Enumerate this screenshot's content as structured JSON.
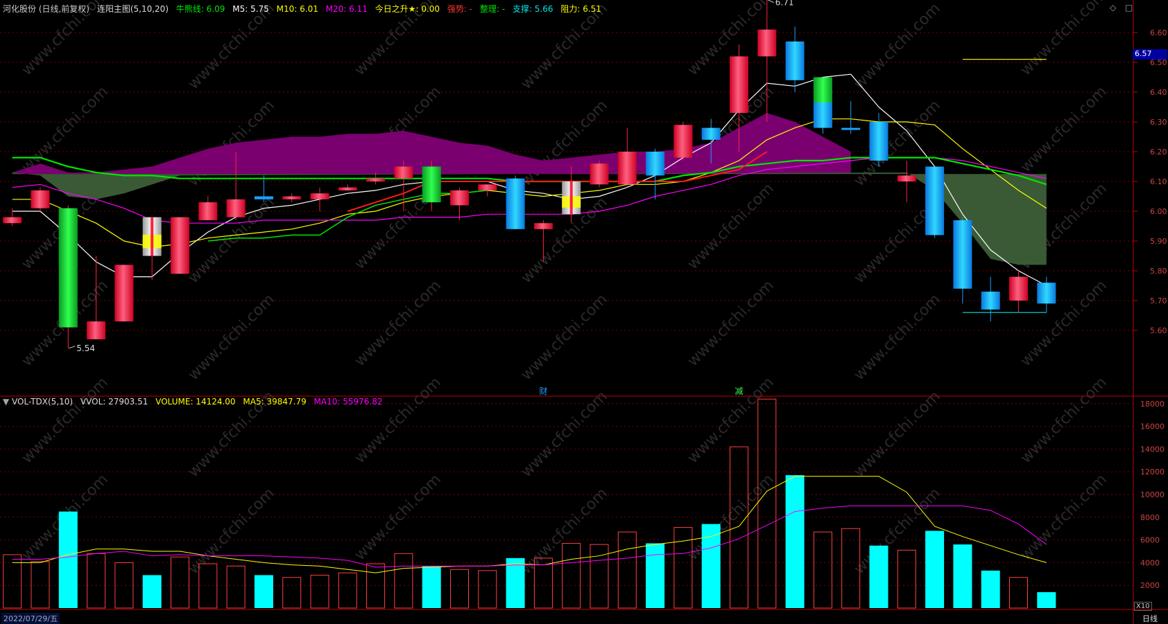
{
  "main_header": {
    "stock": "河化股份 (日线,前复权)",
    "indicator": "连阳主图(5,10,20)",
    "fields": [
      {
        "label": "牛熊线: 6.09",
        "color": "#00e600"
      },
      {
        "label": "M5: 5.75",
        "color": "#ffffff"
      },
      {
        "label": "M10: 6.01",
        "color": "#ffff00"
      },
      {
        "label": "M20: 6.11",
        "color": "#ff00ff"
      },
      {
        "label": "今日之升★: 0.00",
        "color": "#ffff00"
      },
      {
        "label": "强势: -",
        "color": "#ff3333"
      },
      {
        "label": "整理: -",
        "color": "#00e600"
      },
      {
        "label": "支撑: 5.66",
        "color": "#00e6e6"
      },
      {
        "label": "阻力: 6.51",
        "color": "#ffff00"
      }
    ]
  },
  "vol_header": {
    "name": "VOL-TDX(5,10)",
    "vvol": "VVOL: 27903.51",
    "volume": "VOLUME: 14124.00",
    "ma5": "MA5: 39847.79",
    "ma10": "MA10: 55976.82"
  },
  "price_axis": {
    "current_price": "6.57",
    "ticks": [
      "6.60",
      "6.50",
      "6.40",
      "6.30",
      "6.20",
      "6.10",
      "6.00",
      "5.90",
      "5.80",
      "5.70",
      "5.60"
    ]
  },
  "volume_axis": {
    "ticks": [
      "18000",
      "16000",
      "14000",
      "12000",
      "10000",
      "8000",
      "6000",
      "4000",
      "2000"
    ],
    "unit": "X10"
  },
  "annotations": {
    "high": "6.71",
    "low": "5.54",
    "mark1": "财",
    "mark2": "减"
  },
  "date_label": "2022/07/29/五",
  "period_label": "日线",
  "watermark": "www.cfchi.com",
  "colors": {
    "up": "#ff2040",
    "down": "#1aa0ff",
    "grid": "#7a0000",
    "axis": "#c00000",
    "volfill": "#00ffff"
  },
  "chart_data": [
    {
      "type": "candlestick",
      "title": "连阳主图(5,10,20)",
      "ylim": [
        5.52,
        6.72
      ],
      "candles": [
        {
          "o": 5.96,
          "c": 5.98,
          "h": 6.01,
          "l": 5.95,
          "k": "up"
        },
        {
          "o": 6.01,
          "c": 6.07,
          "h": 6.08,
          "l": 6.0,
          "k": "up"
        },
        {
          "o": 6.01,
          "c": 5.61,
          "h": 6.02,
          "l": 5.54,
          "k": "green"
        },
        {
          "o": 5.57,
          "c": 5.63,
          "h": 5.85,
          "l": 5.57,
          "k": "up"
        },
        {
          "o": 5.63,
          "c": 5.82,
          "h": 5.82,
          "l": 5.63,
          "k": "up"
        },
        {
          "o": 5.85,
          "c": 5.98,
          "h": 5.98,
          "l": 5.77,
          "k": "white"
        },
        {
          "o": 5.79,
          "c": 5.98,
          "h": 5.98,
          "l": 5.79,
          "k": "up"
        },
        {
          "o": 5.97,
          "c": 6.03,
          "h": 6.05,
          "l": 5.97,
          "k": "up"
        },
        {
          "o": 5.98,
          "c": 6.04,
          "h": 6.2,
          "l": 5.97,
          "k": "up"
        },
        {
          "o": 6.05,
          "c": 6.04,
          "h": 6.12,
          "l": 6.03,
          "k": "flat"
        },
        {
          "o": 6.04,
          "c": 6.05,
          "h": 6.06,
          "l": 6.03,
          "k": "up"
        },
        {
          "o": 6.04,
          "c": 6.06,
          "h": 6.08,
          "l": 6.0,
          "k": "up"
        },
        {
          "o": 6.07,
          "c": 6.08,
          "h": 6.09,
          "l": 6.07,
          "k": "up"
        },
        {
          "o": 6.1,
          "c": 6.11,
          "h": 6.13,
          "l": 6.09,
          "k": "up"
        },
        {
          "o": 6.11,
          "c": 6.15,
          "h": 6.17,
          "l": 6.0,
          "k": "up"
        },
        {
          "o": 6.03,
          "c": 6.15,
          "h": 6.17,
          "l": 6.0,
          "k": "green"
        },
        {
          "o": 6.02,
          "c": 6.07,
          "h": 6.08,
          "l": 5.97,
          "k": "up"
        },
        {
          "o": 6.09,
          "c": 6.07,
          "h": 6.08,
          "l": 6.05,
          "k": "up"
        },
        {
          "o": 6.11,
          "c": 5.94,
          "h": 6.12,
          "l": 5.94,
          "k": "down"
        },
        {
          "o": 5.94,
          "c": 5.96,
          "h": 5.97,
          "l": 5.83,
          "k": "up"
        },
        {
          "o": 5.99,
          "c": 6.1,
          "h": 6.15,
          "l": 5.96,
          "k": "white"
        },
        {
          "o": 6.09,
          "c": 6.16,
          "h": 6.17,
          "l": 6.08,
          "k": "up"
        },
        {
          "o": 6.09,
          "c": 6.2,
          "h": 6.28,
          "l": 6.08,
          "k": "up"
        },
        {
          "o": 6.2,
          "c": 6.12,
          "h": 6.21,
          "l": 6.04,
          "k": "down"
        },
        {
          "o": 6.18,
          "c": 6.29,
          "h": 6.3,
          "l": 6.17,
          "k": "up"
        },
        {
          "o": 6.28,
          "c": 6.24,
          "h": 6.31,
          "l": 6.16,
          "k": "down"
        },
        {
          "o": 6.33,
          "c": 6.52,
          "h": 6.56,
          "l": 6.2,
          "k": "up"
        },
        {
          "o": 6.52,
          "c": 6.61,
          "h": 6.71,
          "l": 6.3,
          "k": "up"
        },
        {
          "o": 6.57,
          "c": 6.44,
          "h": 6.62,
          "l": 6.4,
          "k": "down"
        },
        {
          "o": 6.45,
          "c": 6.28,
          "h": 6.44,
          "l": 6.26,
          "k": "greendown"
        },
        {
          "o": 6.28,
          "c": 6.28,
          "h": 6.37,
          "l": 6.26,
          "k": "flat"
        },
        {
          "o": 6.3,
          "c": 6.17,
          "h": 6.33,
          "l": 6.15,
          "k": "down"
        },
        {
          "o": 6.1,
          "c": 6.12,
          "h": 6.17,
          "l": 6.03,
          "k": "up"
        },
        {
          "o": 6.15,
          "c": 5.92,
          "h": 6.15,
          "l": 5.91,
          "k": "down"
        },
        {
          "o": 5.97,
          "c": 5.74,
          "h": 5.98,
          "l": 5.69,
          "k": "down"
        },
        {
          "o": 5.73,
          "c": 5.67,
          "h": 5.78,
          "l": 5.63,
          "k": "down"
        },
        {
          "o": 5.7,
          "c": 5.78,
          "h": 5.8,
          "l": 5.66,
          "k": "up"
        },
        {
          "o": 5.76,
          "c": 5.69,
          "h": 5.78,
          "l": 5.66,
          "k": "down"
        }
      ],
      "series": [
        {
          "name": "M5",
          "color": "#ffffff",
          "values": [
            6.0,
            6.0,
            5.92,
            5.83,
            5.78,
            5.78,
            5.86,
            5.93,
            5.98,
            6.01,
            6.02,
            6.04,
            6.06,
            6.07,
            6.09,
            6.1,
            6.1,
            6.1,
            6.07,
            6.06,
            6.04,
            6.05,
            6.08,
            6.12,
            6.18,
            6.23,
            6.34,
            6.43,
            6.42,
            6.45,
            6.46,
            6.35,
            6.27,
            6.15,
            5.99,
            5.87,
            5.8,
            5.75
          ]
        },
        {
          "name": "M10",
          "color": "#ffff00",
          "values": [
            6.04,
            6.04,
            6.0,
            5.96,
            5.9,
            5.88,
            5.89,
            5.91,
            5.92,
            5.93,
            5.94,
            5.96,
            5.99,
            6.0,
            6.03,
            6.05,
            6.06,
            6.07,
            6.06,
            6.05,
            6.06,
            6.07,
            6.09,
            6.09,
            6.1,
            6.13,
            6.17,
            6.24,
            6.28,
            6.31,
            6.31,
            6.3,
            6.3,
            6.29,
            6.21,
            6.14,
            6.07,
            6.01
          ]
        },
        {
          "name": "M20",
          "color": "#ff00ff",
          "values": [
            6.08,
            6.09,
            6.06,
            6.04,
            6.01,
            5.97,
            5.96,
            5.96,
            5.96,
            5.97,
            5.97,
            5.97,
            5.97,
            5.97,
            5.98,
            5.98,
            5.98,
            5.99,
            5.99,
            5.99,
            5.99,
            6.0,
            6.02,
            6.05,
            6.07,
            6.09,
            6.12,
            6.14,
            6.15,
            6.16,
            6.17,
            6.18,
            6.18,
            6.18,
            6.17,
            6.15,
            6.13,
            6.11
          ]
        },
        {
          "name": "牛熊线",
          "color": "#00e600",
          "values": [
            6.18,
            6.18,
            6.15,
            6.13,
            6.12,
            6.12,
            6.11,
            6.11,
            6.11,
            6.11,
            6.11,
            6.11,
            6.11,
            6.11,
            6.11,
            6.11,
            6.11,
            6.11,
            6.1,
            6.1,
            6.1,
            6.1,
            6.1,
            6.1,
            6.12,
            6.13,
            6.15,
            6.16,
            6.17,
            6.17,
            6.18,
            6.18,
            6.18,
            6.18,
            6.16,
            6.14,
            6.12,
            6.09
          ]
        }
      ],
      "line_red": [
        [
          12,
          6.0
        ],
        [
          13,
          6.03
        ],
        [
          14,
          6.06
        ],
        [
          15,
          6.1
        ],
        [
          16,
          6.1
        ],
        [
          17,
          6.1
        ],
        [
          20,
          6.1
        ],
        [
          24,
          6.1
        ],
        [
          26,
          6.14
        ],
        [
          27,
          6.2
        ]
      ],
      "line_green_support": [
        [
          7,
          5.9
        ],
        [
          8,
          5.91
        ],
        [
          9,
          5.91
        ],
        [
          10,
          5.92
        ],
        [
          11,
          5.92
        ],
        [
          12,
          5.98
        ],
        [
          13,
          6.02
        ],
        [
          14,
          6.04
        ],
        [
          15,
          6.06
        ],
        [
          16,
          6.06
        ],
        [
          17,
          6.07
        ]
      ],
      "purple_cloud": [
        [
          0,
          6.13
        ],
        [
          1,
          6.16
        ],
        [
          2,
          6.13
        ],
        [
          3,
          6.13
        ],
        [
          4,
          6.14
        ],
        [
          5,
          6.15
        ],
        [
          6,
          6.18
        ],
        [
          7,
          6.21
        ],
        [
          8,
          6.23
        ],
        [
          9,
          6.24
        ],
        [
          10,
          6.25
        ],
        [
          11,
          6.25
        ],
        [
          12,
          6.26
        ],
        [
          13,
          6.26
        ],
        [
          14,
          6.27
        ],
        [
          15,
          6.25
        ],
        [
          16,
          6.23
        ],
        [
          17,
          6.22
        ],
        [
          18,
          6.19
        ],
        [
          19,
          6.17
        ],
        [
          20,
          6.18
        ],
        [
          21,
          6.19
        ],
        [
          22,
          6.2
        ],
        [
          23,
          6.2
        ],
        [
          24,
          6.21
        ],
        [
          25,
          6.23
        ],
        [
          26,
          6.28
        ],
        [
          27,
          6.33
        ],
        [
          28,
          6.3
        ],
        [
          29,
          6.25
        ],
        [
          30,
          6.2
        ]
      ],
      "green_cloud": [
        [
          0,
          6.13
        ],
        [
          1,
          6.12
        ],
        [
          2,
          6.05
        ],
        [
          3,
          6.04
        ],
        [
          4,
          6.06
        ],
        [
          5,
          6.09
        ],
        [
          6,
          6.12
        ],
        [
          31,
          6.13
        ],
        [
          32,
          6.13
        ],
        [
          33,
          6.07
        ],
        [
          34,
          5.96
        ],
        [
          35,
          5.84
        ],
        [
          36,
          5.82
        ],
        [
          37,
          5.82
        ]
      ],
      "resistance_line": [
        [
          34,
          6.51
        ],
        [
          37,
          6.51
        ]
      ],
      "support_line": [
        [
          34,
          5.66
        ],
        [
          37,
          5.66
        ]
      ]
    },
    {
      "type": "bar",
      "title": "VOL-TDX(5,10)",
      "ylim": [
        0,
        19000
      ],
      "values": [
        4700,
        4100,
        8500,
        4800,
        4000,
        2900,
        4500,
        3900,
        3700,
        2900,
        2700,
        2900,
        3100,
        3900,
        4800,
        3700,
        3400,
        3300,
        4400,
        4400,
        5700,
        5600,
        6700,
        5700,
        7100,
        7400,
        14200,
        18400,
        11700,
        6700,
        7000,
        5500,
        5100,
        6800,
        5600,
        3300,
        2700,
        1400
      ],
      "filled": [
        false,
        false,
        true,
        false,
        false,
        true,
        false,
        false,
        false,
        true,
        false,
        false,
        false,
        false,
        false,
        true,
        false,
        false,
        true,
        false,
        false,
        false,
        false,
        true,
        false,
        true,
        false,
        false,
        true,
        false,
        false,
        true,
        false,
        true,
        true,
        true,
        false,
        true
      ],
      "series": [
        {
          "name": "MA5",
          "color": "#ffff00",
          "values": [
            4000,
            4000,
            4700,
            5200,
            5200,
            5000,
            5000,
            4600,
            4300,
            4000,
            3800,
            3700,
            3400,
            3100,
            3500,
            3600,
            3700,
            3700,
            3900,
            3800,
            4300,
            4600,
            5200,
            5600,
            5900,
            6300,
            7200,
            10300,
            11600,
            11600,
            11600,
            11600,
            10200,
            7200,
            6300,
            5500,
            4700,
            4000
          ]
        },
        {
          "name": "MA10",
          "color": "#ff00ff",
          "values": [
            4300,
            4300,
            4500,
            4800,
            5000,
            4600,
            4700,
            4600,
            4600,
            4600,
            4500,
            4400,
            4200,
            3600,
            3700,
            3700,
            3700,
            3700,
            3800,
            3800,
            4000,
            4200,
            4400,
            4700,
            4800,
            5300,
            6100,
            7300,
            8500,
            8800,
            9000,
            9000,
            9000,
            9000,
            9000,
            8600,
            7400,
            5600
          ]
        }
      ]
    }
  ]
}
